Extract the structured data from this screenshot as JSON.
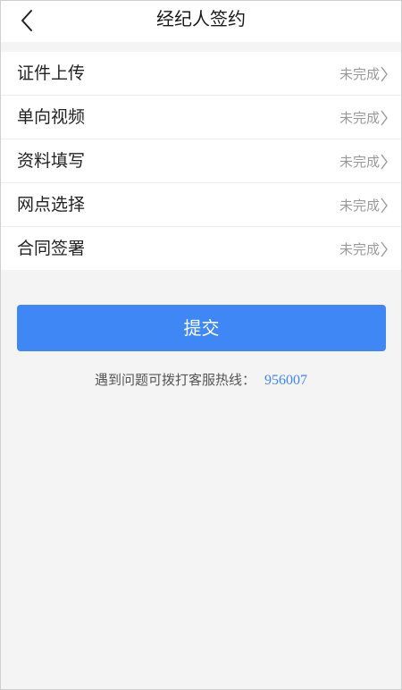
{
  "header": {
    "title": "经纪人签约",
    "back_icon": "chevron-left-icon"
  },
  "steps": [
    {
      "label": "证件上传",
      "status": "未完成"
    },
    {
      "label": "单向视频",
      "status": "未完成"
    },
    {
      "label": "资料填写",
      "status": "未完成"
    },
    {
      "label": "网点选择",
      "status": "未完成"
    },
    {
      "label": "合同签署",
      "status": "未完成"
    }
  ],
  "submit": {
    "label": "提交"
  },
  "help": {
    "text": "遇到问题可拨打客服热线：",
    "phone": "956007"
  },
  "colors": {
    "primary": "#3f87f5",
    "background": "#f4f4f4",
    "status_text": "#9a9a9a"
  }
}
